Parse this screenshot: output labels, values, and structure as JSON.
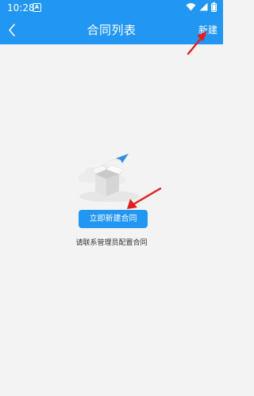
{
  "status_bar": {
    "time": "10:28",
    "app_icon": "A",
    "icons": [
      "wifi-icon",
      "signal-icon",
      "battery-icon"
    ]
  },
  "header": {
    "back_icon": "chevron-left-icon",
    "title": "合同列表",
    "new_label": "新建"
  },
  "empty_state": {
    "illustration": "empty-box-paper-plane",
    "create_button_label": "立即新建合同",
    "hint": "请联系管理员配置合同"
  },
  "annotations": {
    "arrow_color": "#e02020"
  },
  "colors": {
    "accent": "#2196f3",
    "background": "#f3f3f3"
  }
}
